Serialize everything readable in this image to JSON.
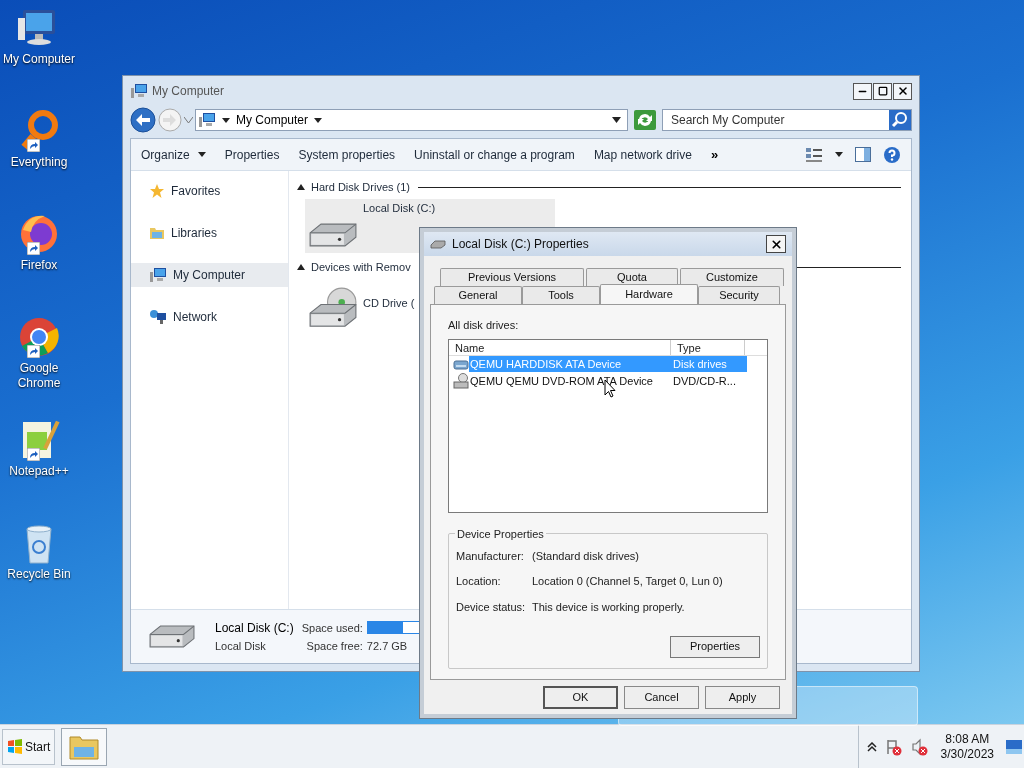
{
  "desktop_icons": [
    {
      "label": "My Computer",
      "kind": "computer",
      "shortcut": false
    },
    {
      "label": "Everything",
      "kind": "everything",
      "shortcut": true
    },
    {
      "label": "Firefox",
      "kind": "firefox",
      "shortcut": true
    },
    {
      "label": "Google Chrome",
      "kind": "chrome",
      "shortcut": true
    },
    {
      "label": "Notepad++",
      "kind": "notepad",
      "shortcut": true
    },
    {
      "label": "Recycle Bin",
      "kind": "recycle",
      "shortcut": false
    }
  ],
  "explorer": {
    "title": "My Computer",
    "address": "My Computer",
    "search": {
      "placeholder": "Search My Computer"
    },
    "toolbar": [
      {
        "label": "Organize",
        "kind": "menu"
      },
      {
        "label": "Properties",
        "kind": "button"
      },
      {
        "label": "System properties",
        "kind": "button"
      },
      {
        "label": "Uninstall or change a program",
        "kind": "button"
      },
      {
        "label": "Map network drive",
        "kind": "button"
      },
      {
        "label": "»",
        "kind": "more"
      }
    ],
    "nav": [
      {
        "label": "Favorites",
        "kind": "star",
        "selected": false
      },
      {
        "label": "Libraries",
        "kind": "library",
        "selected": false
      },
      {
        "label": "My Computer",
        "kind": "computer",
        "selected": true
      },
      {
        "label": "Network",
        "kind": "network",
        "selected": false
      }
    ],
    "groups": [
      {
        "title": "Hard Disk Drives (1)",
        "items": [
          {
            "label": "Local Disk (C:)",
            "kind": "hdd",
            "selected": true
          }
        ]
      },
      {
        "title": "Devices with Remov",
        "items": [
          {
            "label": "CD Drive (",
            "kind": "cd",
            "selected": false
          }
        ]
      }
    ],
    "details": {
      "name": "Local Disk (C:)",
      "type": "Local Disk",
      "used_label": "Space used:",
      "level": 0.62,
      "free_label": "Space free:",
      "free_value": "72.7 GB"
    }
  },
  "dialog": {
    "title": "Local Disk (C:) Properties",
    "tab_rows": [
      [
        {
          "label": "Previous Versions",
          "selected": false
        },
        {
          "label": "Quota",
          "selected": false
        },
        {
          "label": "Customize",
          "selected": false
        }
      ],
      [
        {
          "label": "General",
          "selected": false
        },
        {
          "label": "Tools",
          "selected": false
        },
        {
          "label": "Hardware",
          "selected": true
        },
        {
          "label": "Security",
          "selected": false
        }
      ]
    ],
    "list_label": "All disk drives:",
    "columns": [
      "Name",
      "Type"
    ],
    "devices": [
      {
        "name": "QEMU HARDDISK ATA Device",
        "type": "Disk drives",
        "kind": "hdd",
        "selected": true
      },
      {
        "name": "QEMU QEMU DVD-ROM ATA Device",
        "type": "DVD/CD-R...",
        "kind": "dvd",
        "selected": false
      }
    ],
    "group_title": "Device Properties",
    "properties": [
      {
        "label": "Manufacturer:",
        "value": "(Standard disk drives)"
      },
      {
        "label": "Location:",
        "value": "Location 0 (Channel 5, Target 0, Lun 0)"
      },
      {
        "label": "Device status:",
        "value": "This device is working properly."
      }
    ],
    "properties_button": "Properties",
    "buttons": [
      "OK",
      "Cancel",
      "Apply"
    ]
  },
  "taskbar": {
    "start": "Start",
    "time": "8:08 AM",
    "date": "3/30/2023"
  }
}
